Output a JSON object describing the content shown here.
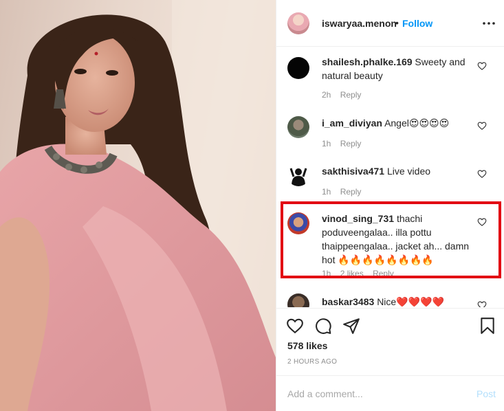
{
  "post_header": {
    "username": "iswaryaa.menon",
    "separator": "•",
    "follow_label": "Follow"
  },
  "comments": [
    {
      "username": "shailesh.phalke.169",
      "text": "Sweety and natural beauty",
      "time": "2h",
      "reply": "Reply",
      "avatar": "black-circle"
    },
    {
      "username": "i_am_diviyan",
      "text": "Angel😍😍😍😍",
      "time": "1h",
      "reply": "Reply",
      "avatar": "person-photo"
    },
    {
      "username": "sakthisiva471",
      "text": "Live video",
      "time": "1h",
      "reply": "Reply",
      "avatar": "silhouette"
    },
    {
      "username": "vinod_sing_731",
      "text": "thachi poduveengalaa.. illa pottu thaippeengalaa.. jacket ah... damn hot 🔥🔥🔥🔥🔥🔥🔥🔥",
      "time": "1h",
      "reply": "Reply",
      "likes": "2 likes",
      "avatar": "cartoon-face"
    },
    {
      "username": "baskar3483",
      "text": "Nice❤️❤️❤️❤️",
      "time": "",
      "reply": "",
      "avatar": "person-photo"
    }
  ],
  "actions": {
    "likes": "578 likes",
    "timestamp": "2 HOURS AGO",
    "icons": [
      "heart-icon",
      "comment-icon",
      "share-icon",
      "bookmark-icon"
    ]
  },
  "add_comment": {
    "placeholder": "Add a comment...",
    "post_label": "Post"
  },
  "colors": {
    "follow": "#0095f6",
    "highlight": "#e20613",
    "muted": "#8e8e8e"
  }
}
